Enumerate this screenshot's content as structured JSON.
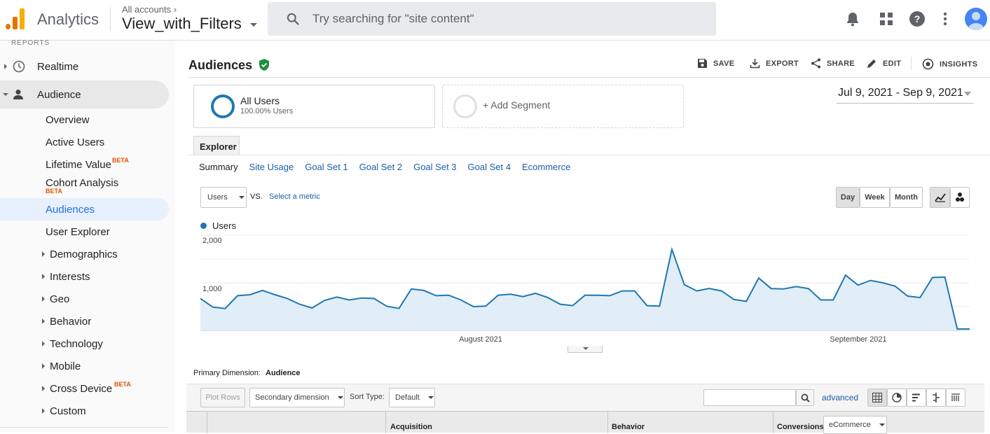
{
  "header": {
    "app_name": "Analytics",
    "account_small": "All accounts",
    "account_chevron": "›",
    "view_name": "View_with_Filters",
    "search_placeholder": "Try searching for \"site content\""
  },
  "sidebar": {
    "reports_label": "REPORTS",
    "realtime": "Realtime",
    "audience": "Audience",
    "items": [
      {
        "label": "Overview"
      },
      {
        "label": "Active Users"
      },
      {
        "label": "Lifetime Value",
        "badge": "BETA"
      },
      {
        "label": "Cohort Analysis",
        "badge": "BETA"
      },
      {
        "label": "Audiences"
      },
      {
        "label": "User Explorer"
      },
      {
        "label": "Demographics"
      },
      {
        "label": "Interests"
      },
      {
        "label": "Geo"
      },
      {
        "label": "Behavior"
      },
      {
        "label": "Technology"
      },
      {
        "label": "Mobile"
      },
      {
        "label": "Cross Device",
        "badge": "BETA"
      },
      {
        "label": "Custom"
      }
    ]
  },
  "main": {
    "title": "Audiences",
    "actions": {
      "save": "SAVE",
      "export": "EXPORT",
      "share": "SHARE",
      "edit": "EDIT",
      "insights": "INSIGHTS"
    },
    "segment": {
      "name": "All Users",
      "pct": "100.00% Users",
      "add": "+ Add Segment"
    },
    "date_range": "Jul 9, 2021 - Sep 9, 2021",
    "explorer_tab": "Explorer",
    "subtabs": [
      "Summary",
      "Site Usage",
      "Goal Set 1",
      "Goal Set 2",
      "Goal Set 3",
      "Goal Set 4",
      "Ecommerce"
    ],
    "metric_select": "Users",
    "vs": "VS.",
    "select_metric": "Select a metric",
    "periods": [
      "Day",
      "Week",
      "Month"
    ],
    "primary_dimension_label": "Primary Dimension:",
    "primary_dimension_value": "Audience",
    "plot_rows": "Plot Rows",
    "secondary_dimension": "Secondary dimension",
    "sort_type_label": "Sort Type:",
    "sort_type_value": "Default",
    "advanced": "advanced",
    "table_headers": {
      "acquisition": "Acquisition",
      "behavior": "Behavior",
      "conversions": "Conversions",
      "conversions_select": "eCommerce"
    }
  },
  "colors": {
    "accent": "#1a73e8",
    "series": "#1f77b4",
    "beta": "#e65100"
  },
  "chart_data": {
    "type": "area",
    "legend": [
      "Users"
    ],
    "y_ticks": [
      "2,000",
      "1,000"
    ],
    "x_labels": [
      "August 2021",
      "September 2021"
    ],
    "ylim": [
      0,
      2000
    ],
    "grid": true,
    "series": [
      {
        "name": "Users",
        "values": [
          670,
          490,
          460,
          730,
          750,
          840,
          750,
          670,
          550,
          470,
          630,
          700,
          640,
          680,
          670,
          510,
          460,
          870,
          840,
          730,
          740,
          640,
          500,
          510,
          740,
          760,
          710,
          780,
          690,
          550,
          520,
          740,
          740,
          730,
          830,
          830,
          520,
          510,
          1700,
          960,
          830,
          880,
          830,
          650,
          610,
          1100,
          880,
          870,
          920,
          880,
          640,
          640,
          1160,
          950,
          1050,
          1000,
          930,
          720,
          690,
          1110,
          1120,
          30,
          30
        ]
      }
    ]
  }
}
